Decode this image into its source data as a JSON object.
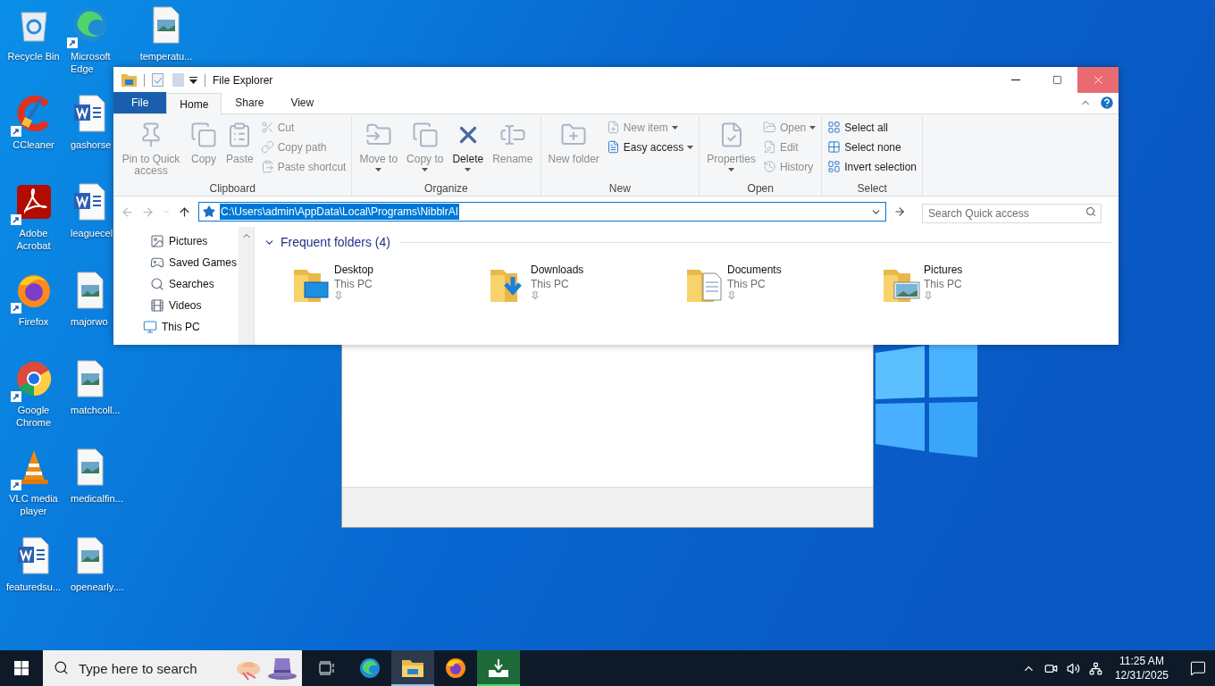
{
  "desktop": {
    "columns": [
      [
        {
          "label": "Recycle Bin",
          "kind": "recycle",
          "shortcut": false
        },
        {
          "label": "CCleaner",
          "kind": "ccleaner",
          "shortcut": true
        },
        {
          "label": "Adobe Acrobat",
          "kind": "acrobat",
          "shortcut": true
        },
        {
          "label": "Firefox",
          "kind": "firefox",
          "shortcut": true
        },
        {
          "label": "Google Chrome",
          "kind": "chrome",
          "shortcut": true
        },
        {
          "label": "VLC media player",
          "kind": "vlc",
          "shortcut": true
        },
        {
          "label": "featuredsu...",
          "kind": "word",
          "shortcut": false
        }
      ],
      [
        {
          "label": "Microsoft Edge",
          "kind": "edge",
          "shortcut": true
        },
        {
          "label": "gashorse",
          "kind": "word",
          "shortcut": false
        },
        {
          "label": "leaguecel",
          "kind": "word",
          "shortcut": false
        },
        {
          "label": "majorwo",
          "kind": "image",
          "shortcut": false
        },
        {
          "label": "matchcoll...",
          "kind": "image",
          "shortcut": false
        },
        {
          "label": "medicalfin...",
          "kind": "image",
          "shortcut": false
        },
        {
          "label": "openearly....",
          "kind": "image",
          "shortcut": false
        }
      ],
      [
        {
          "label": "temperatu...",
          "kind": "image",
          "shortcut": false
        }
      ]
    ]
  },
  "explorer": {
    "title": "File Explorer",
    "tabs": [
      {
        "label": "File",
        "kind": "file",
        "selected": false
      },
      {
        "label": "Home",
        "kind": "tab",
        "selected": true
      },
      {
        "label": "Share",
        "kind": "tab",
        "selected": false
      },
      {
        "label": "View",
        "kind": "tab",
        "selected": false
      }
    ],
    "ribbon": {
      "groups": [
        {
          "label": "Clipboard",
          "buttons": [
            {
              "kind": "pin",
              "label": "Pin to Quick access",
              "disabled": true,
              "dropdown": false
            },
            {
              "kind": "copy",
              "label": "Copy",
              "disabled": true,
              "dropdown": false
            },
            {
              "kind": "paste",
              "label": "Paste",
              "disabled": true,
              "dropdown": false
            }
          ],
          "stack": [
            {
              "kind": "cut",
              "label": "Cut",
              "disabled": true,
              "dropdown": false
            },
            {
              "kind": "copypath",
              "label": "Copy path",
              "disabled": true,
              "dropdown": false
            },
            {
              "kind": "pasteshortcut",
              "label": "Paste shortcut",
              "disabled": true,
              "dropdown": false
            }
          ]
        },
        {
          "label": "Organize",
          "buttons": [
            {
              "kind": "move",
              "label": "Move to",
              "disabled": true,
              "dropdown": true
            },
            {
              "kind": "copyto",
              "label": "Copy to",
              "disabled": true,
              "dropdown": true
            },
            {
              "kind": "delete",
              "label": "Delete",
              "disabled": false,
              "dropdown": true
            },
            {
              "kind": "rename",
              "label": "Rename",
              "disabled": true,
              "dropdown": false
            }
          ]
        },
        {
          "label": "New",
          "buttons": [
            {
              "kind": "newfolder",
              "label": "New folder",
              "disabled": true,
              "dropdown": false
            }
          ],
          "stack": [
            {
              "kind": "newitem",
              "label": "New item",
              "disabled": true,
              "dropdown": true
            },
            {
              "kind": "easyaccess",
              "label": "Easy access",
              "disabled": false,
              "dropdown": true
            }
          ]
        },
        {
          "label": "Open",
          "buttons": [
            {
              "kind": "properties",
              "label": "Properties",
              "disabled": true,
              "dropdown": true
            }
          ],
          "stack": [
            {
              "kind": "open",
              "label": "Open",
              "disabled": true,
              "dropdown": true
            },
            {
              "kind": "edit",
              "label": "Edit",
              "disabled": true,
              "dropdown": false
            },
            {
              "kind": "history",
              "label": "History",
              "disabled": true,
              "dropdown": false
            }
          ]
        },
        {
          "label": "Select",
          "stack": [
            {
              "kind": "selectall",
              "label": "Select all",
              "disabled": false,
              "dropdown": false
            },
            {
              "kind": "selectnone",
              "label": "Select none",
              "disabled": false,
              "dropdown": false
            },
            {
              "kind": "invert",
              "label": "Invert selection",
              "disabled": false,
              "dropdown": false
            }
          ]
        }
      ]
    },
    "address": {
      "value": "C:\\Users\\admin\\AppData\\Local\\Programs\\NibblrAI",
      "selected": true
    },
    "search": {
      "placeholder": "Search Quick access"
    },
    "nav_items": [
      {
        "label": "Pictures",
        "kind": "pictures"
      },
      {
        "label": "Saved Games",
        "kind": "games"
      },
      {
        "label": "Searches",
        "kind": "searches"
      },
      {
        "label": "Videos",
        "kind": "videos"
      }
    ],
    "nav_root": {
      "label": "This PC",
      "kind": "pc"
    },
    "section": {
      "title": "Frequent folders (4)",
      "expanded": true
    },
    "folders": [
      {
        "name": "Desktop",
        "location": "This PC",
        "kind": "desktop",
        "pinned": true
      },
      {
        "name": "Downloads",
        "location": "This PC",
        "kind": "downloads",
        "pinned": true
      },
      {
        "name": "Documents",
        "location": "This PC",
        "kind": "documents",
        "pinned": true
      },
      {
        "name": "Pictures",
        "location": "This PC",
        "kind": "pictures",
        "pinned": true
      }
    ]
  },
  "taskbar": {
    "search": {
      "placeholder": "Type here to search"
    },
    "apps": [
      {
        "kind": "taskview",
        "open": false,
        "selected": false
      },
      {
        "kind": "edge",
        "open": false,
        "selected": false
      },
      {
        "kind": "explorer",
        "open": true,
        "selected": false
      },
      {
        "kind": "firefox",
        "open": false,
        "selected": false
      },
      {
        "kind": "installer",
        "open": true,
        "selected": true
      }
    ],
    "time": "11:25 AM",
    "date": "12/31/2025"
  }
}
